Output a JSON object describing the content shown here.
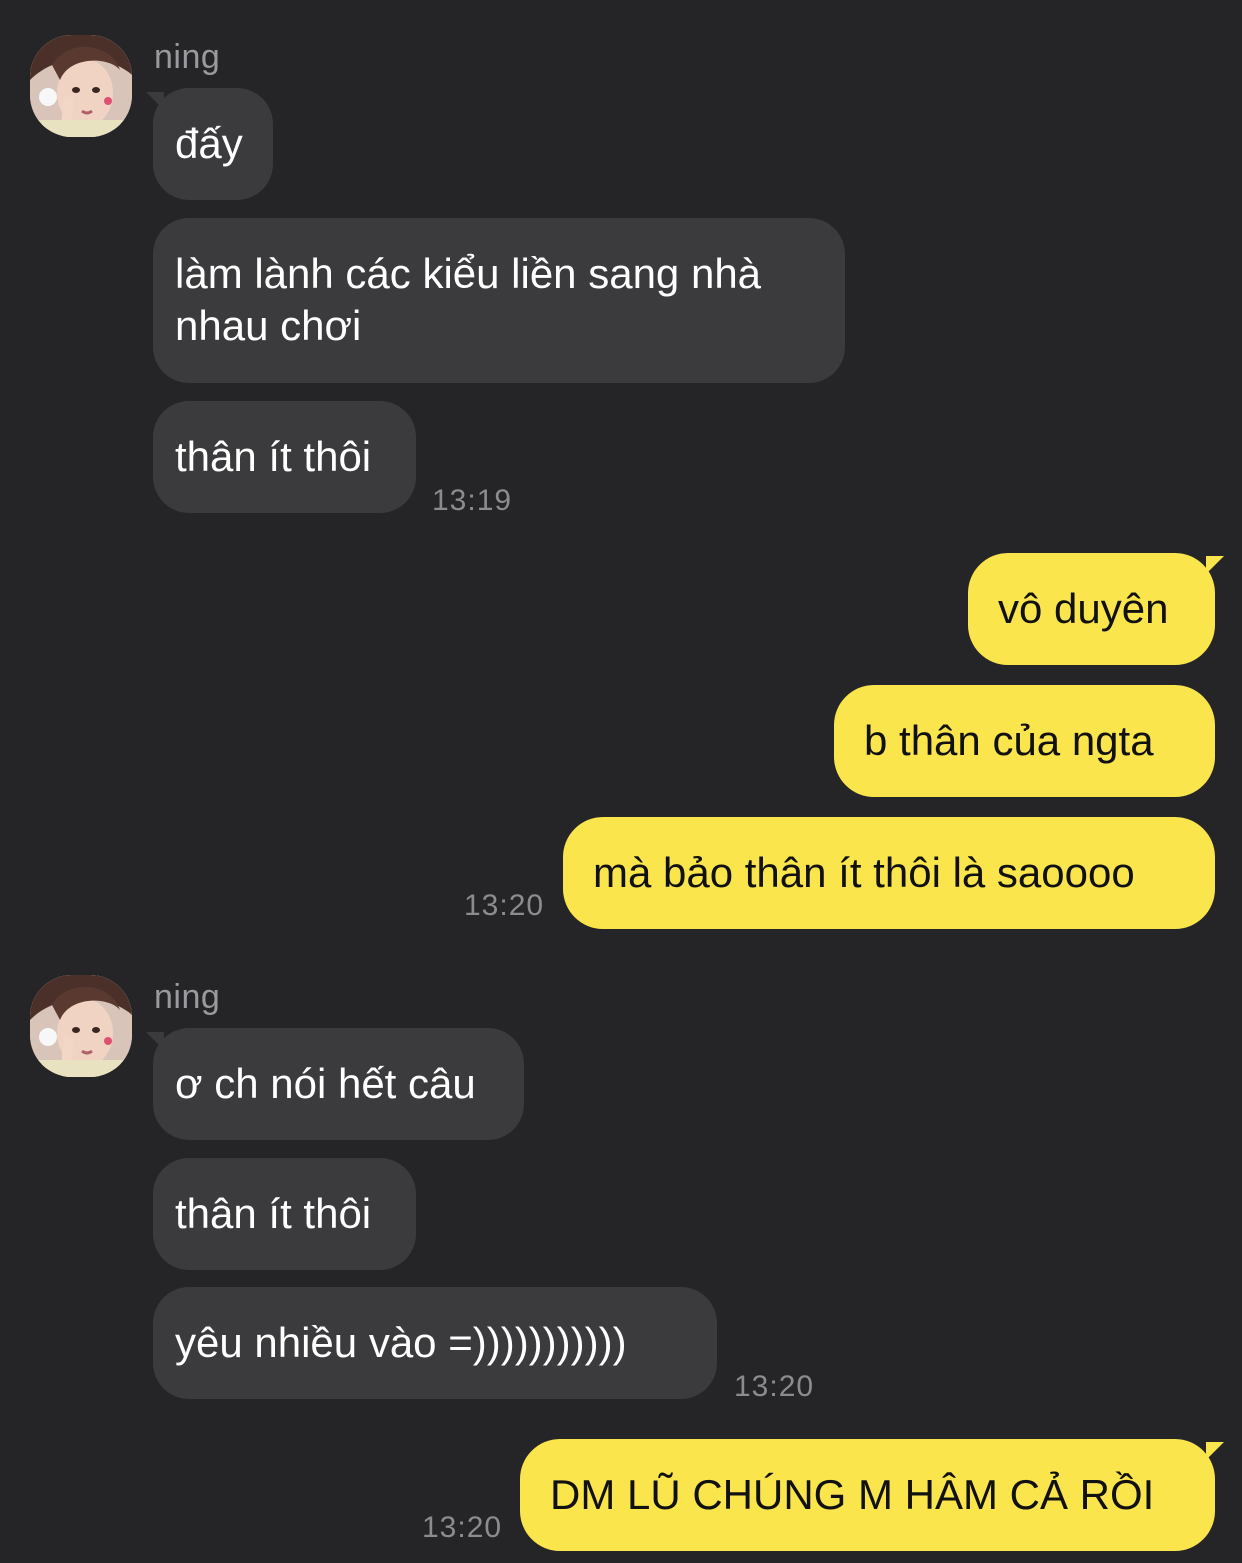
{
  "colors": {
    "background": "#252527",
    "incoming_bubble": "#3b3b3d",
    "outgoing_bubble": "#fbe54d",
    "timestamp": "#8c8c90"
  },
  "groups": [
    {
      "sender": "ning",
      "avatar": "contact-avatar-photo",
      "messages": [
        "đấy",
        "làm lành các kiểu liền sang nhà nhau chơi",
        "thân ít thôi"
      ],
      "time": "13:19"
    },
    {
      "sender": "me",
      "messages": [
        "vô duyên",
        "b thân của ngta",
        "mà bảo thân ít thôi là saoooo"
      ],
      "time": "13:20"
    },
    {
      "sender": "ning",
      "avatar": "contact-avatar-photo",
      "messages": [
        "ơ ch nói hết câu",
        "thân ít thôi",
        "yêu nhiều vào =)))))))))))"
      ],
      "time": "13:20"
    },
    {
      "sender": "me",
      "messages": [
        "DM LŨ CHÚNG M HÂM CẢ RỒI"
      ],
      "time": "13:20"
    }
  ]
}
